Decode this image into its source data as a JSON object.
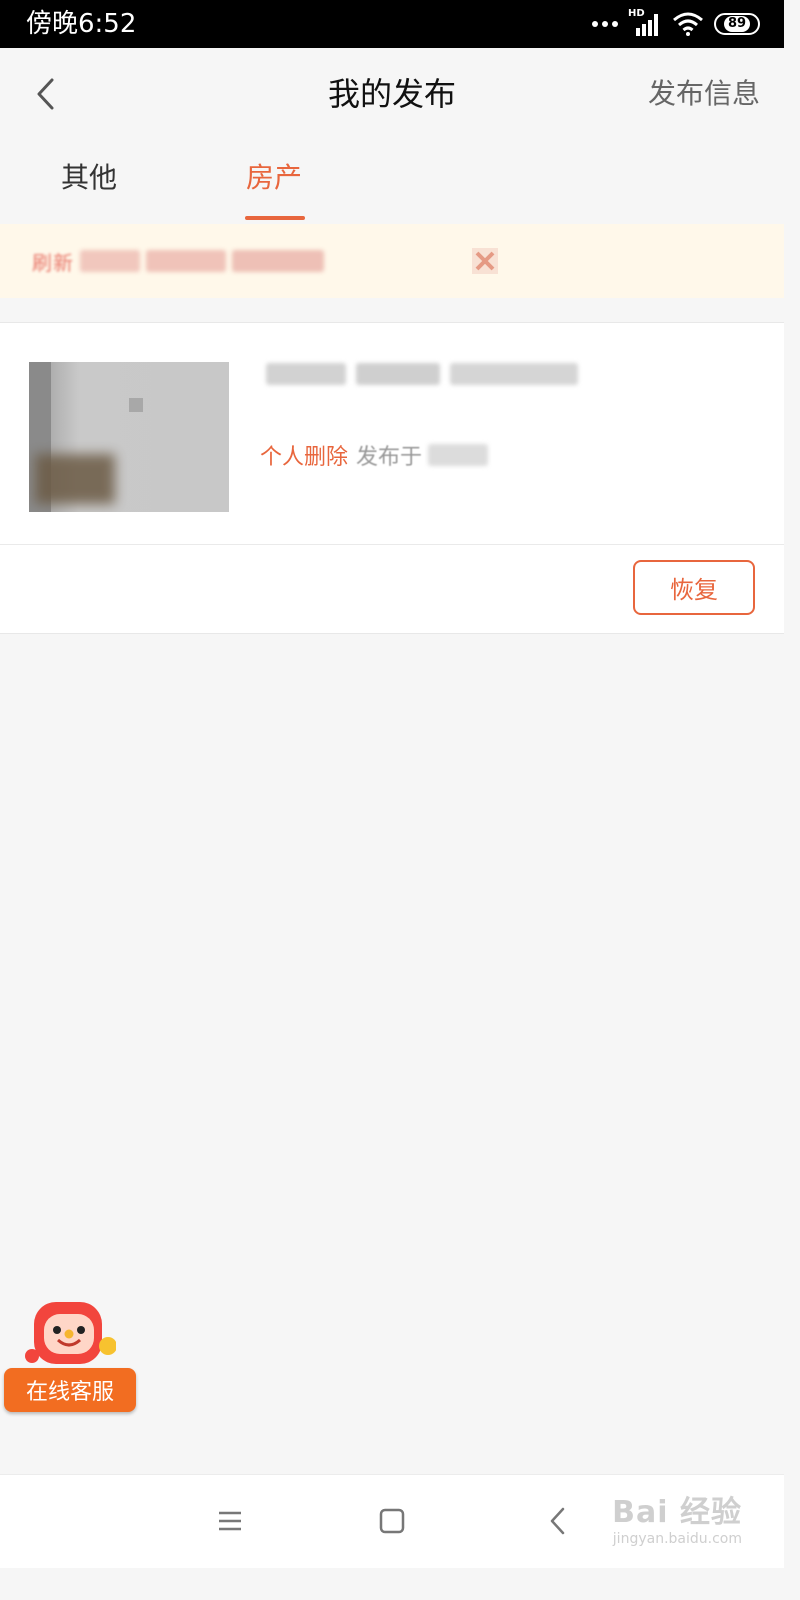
{
  "status_bar": {
    "time": "傍晚6:52",
    "network_label": "HD",
    "battery": "89"
  },
  "header": {
    "title": "我的发布",
    "publish_label": "发布信息"
  },
  "tabs": [
    {
      "label": "其他",
      "active": false
    },
    {
      "label": "房产",
      "active": true
    }
  ],
  "notice": {
    "lead_text": "刷新"
  },
  "listing": {
    "status": "个人删除",
    "date_label": "发布于",
    "restore_label": "恢复"
  },
  "support": {
    "label": "在线客服"
  },
  "watermark": {
    "brand": "Bai 经验",
    "url": "jingyan.baidu.com"
  },
  "colors": {
    "accent": "#e8663d",
    "support": "#f26d21",
    "background": "#f6f6f6",
    "notice_bg": "#fff8ea"
  }
}
